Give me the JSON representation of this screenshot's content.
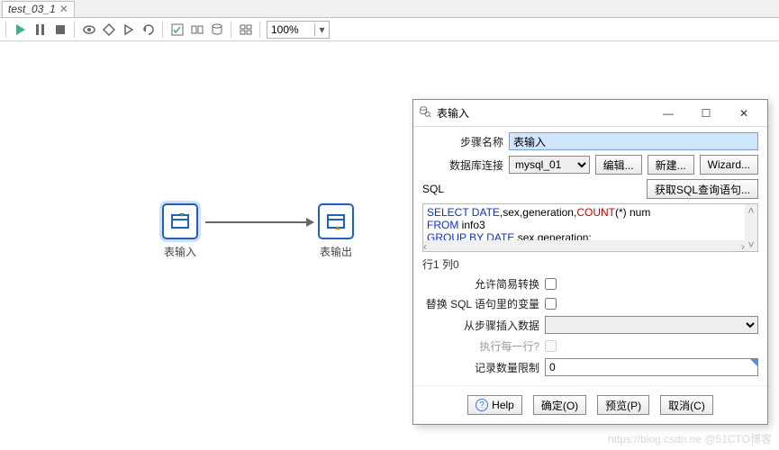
{
  "tab": {
    "name": "test_03_1",
    "close_glyph": "✕"
  },
  "toolbar": {
    "icons": [
      "triangle",
      "pause",
      "stop",
      "eye",
      "kite",
      "play",
      "play2",
      "magic",
      "grid",
      "grid2",
      "db",
      "layout"
    ],
    "zoom_value": "100%"
  },
  "canvas": {
    "node_input_label": "表输入",
    "node_output_label": "表输出"
  },
  "dialog": {
    "title": "表输入",
    "labels": {
      "step_name": "步骤名称",
      "db_conn": "数据库连接",
      "sql": "SQL",
      "get_sql_btn": "获取SQL查询语句...",
      "edit_btn": "编辑...",
      "new_btn": "新建...",
      "wizard_btn": "Wizard...",
      "cursor": "行1 列0",
      "allow_simple": "允许简易转换",
      "replace_vars": "替换 SQL 语句里的变量",
      "from_step": "从步骤插入数据",
      "exec_each": "执行每一行?",
      "limit": "记录数量限制"
    },
    "values": {
      "step_name": "表输入",
      "db_conn": "mysql_01",
      "limit": "0"
    },
    "sql_tokens": {
      "l1a": "SELECT DATE",
      "l1b": ",sex,generation,",
      "l1c": "COUNT",
      "l1d": "(*) num",
      "l2a": "FROM",
      "l2b": " info3",
      "l3a": "GROUP BY DATE",
      "l3b": ",sex,generation;"
    },
    "disabled_color": "#9a9a9a",
    "buttons": {
      "help": "Help",
      "ok": "确定(O)",
      "preview": "预览(P)",
      "cancel": "取消(C)"
    }
  },
  "watermark": "https://blog.csdn.ne @51CTO博客"
}
